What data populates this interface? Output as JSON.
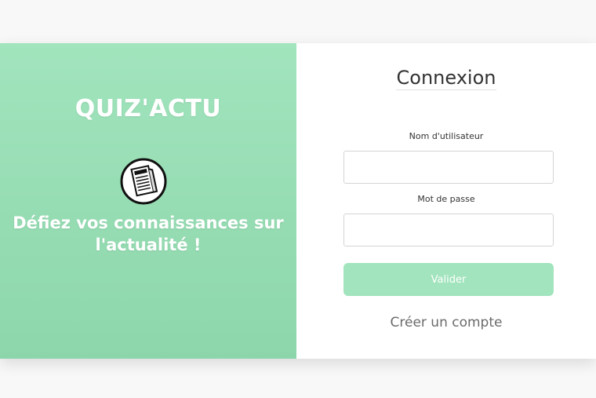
{
  "brand": {
    "title": "QUIZ'ACTU",
    "tagline": "Défiez vos connaissances sur l'actualité !",
    "logo_icon": "newspaper-icon"
  },
  "login": {
    "title": "Connexion",
    "username_label": "Nom d'utilisateur",
    "username_value": "",
    "password_label": "Mot de passe",
    "password_value": "",
    "submit_label": "Valider",
    "create_account_label": "Créer un compte"
  },
  "colors": {
    "accent": "#a1e4bd",
    "page_background": "#f8f8f8",
    "text_dark": "#333333"
  }
}
